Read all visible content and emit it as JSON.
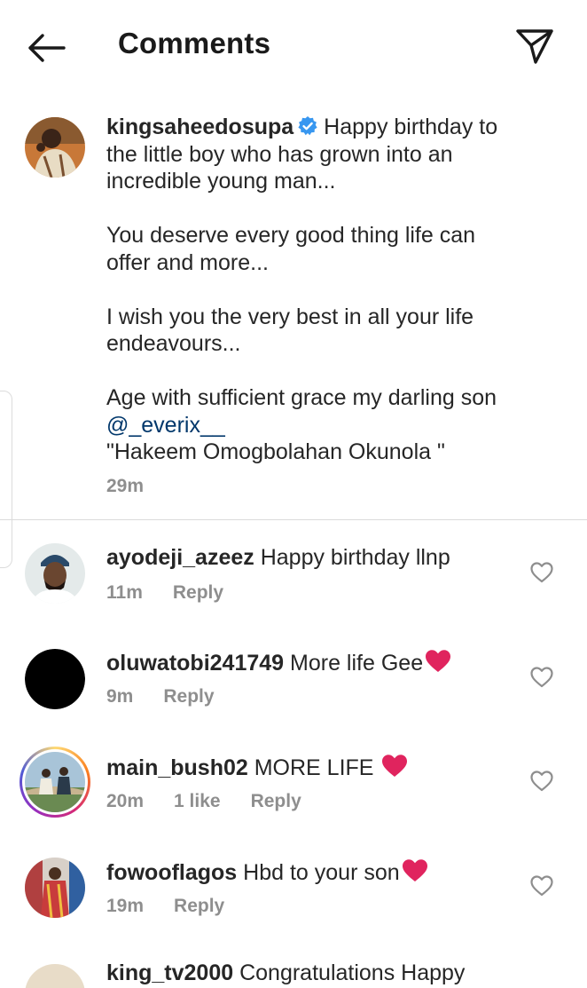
{
  "header": {
    "title": "Comments",
    "back_icon": "arrow-left-icon",
    "share_icon": "paper-plane-icon"
  },
  "caption": {
    "username": "kingsaheedosupa",
    "verified": true,
    "text_part1": "Happy birthday to the little boy who has grown into an incredible young man...\n\nYou deserve every good thing life can offer and more...\n\nI wish you the very best in all your life endeavours...\n\nAge with sufficient grace my darling son ",
    "mention": "@_everix__",
    "text_part2": "\n\"Hakeem Omogbolahan Okunola \"",
    "time": "29m"
  },
  "comments": [
    {
      "username": "ayodeji_azeez",
      "text": "Happy birthday llnp",
      "emoji": "",
      "time": "11m",
      "likes": "",
      "reply": "Reply"
    },
    {
      "username": "oluwatobi241749",
      "text": "More life Gee",
      "emoji": "red-heart",
      "time": "9m",
      "likes": "",
      "reply": "Reply"
    },
    {
      "username": "main_bush02",
      "text": "MORE LIFE ",
      "emoji": "red-heart",
      "time": "20m",
      "likes": "1 like",
      "reply": "Reply"
    },
    {
      "username": "fowooflagos",
      "text": "Hbd to your son",
      "emoji": "red-heart",
      "time": "19m",
      "likes": "",
      "reply": "Reply"
    },
    {
      "username": "king_tv2000",
      "text": "Congratulations Happy",
      "emoji": "",
      "time": "",
      "likes": "",
      "reply": ""
    }
  ],
  "colors": {
    "text": "#262626",
    "meta": "#8e8e8e",
    "mention": "#00376b",
    "verified": "#3897f0",
    "heart_emoji": "#e0245e"
  }
}
